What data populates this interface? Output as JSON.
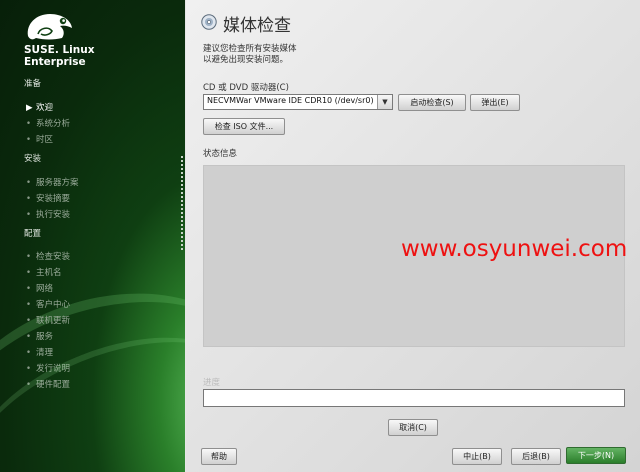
{
  "sidebar": {
    "brand_line1": "SUSE. Linux",
    "brand_line2": "Enterprise",
    "sections": [
      {
        "title": "准备",
        "items": [
          {
            "label": "欢迎",
            "active": true
          },
          {
            "label": "系统分析",
            "active": false
          },
          {
            "label": "时区",
            "active": false
          }
        ]
      },
      {
        "title": "安装",
        "items": [
          {
            "label": "服务器方案",
            "active": false
          },
          {
            "label": "安装摘要",
            "active": false
          },
          {
            "label": "执行安装",
            "active": false
          }
        ]
      },
      {
        "title": "配置",
        "items": [
          {
            "label": "检查安装",
            "active": false
          },
          {
            "label": "主机名",
            "active": false
          },
          {
            "label": "网络",
            "active": false
          },
          {
            "label": "客户中心",
            "active": false
          },
          {
            "label": "联机更新",
            "active": false
          },
          {
            "label": "服务",
            "active": false
          },
          {
            "label": "清理",
            "active": false
          },
          {
            "label": "发行说明",
            "active": false
          },
          {
            "label": "硬件配置",
            "active": false
          }
        ]
      }
    ]
  },
  "main": {
    "title": "媒体检查",
    "description_line1": "建议您检查所有安装媒体",
    "description_line2": "以避免出现安装问题。",
    "drive_label": "CD 或 DVD 驱动器(C)",
    "drive_value": "NECVMWar VMware IDE CDR10 (/dev/sr0)",
    "start_check_button": "启动检查(S)",
    "eject_button": "弹出(E)",
    "check_iso_button": "检查 ISO 文件...",
    "status_label": "状态信息",
    "progress_label": "进度",
    "progress_value": 0,
    "cancel_button": "取消(C)"
  },
  "footer": {
    "help_button": "帮助",
    "abort_button": "中止(B)",
    "back_button": "后退(B)",
    "next_button": "下一步(N)"
  },
  "watermark": "www.osyunwei.com",
  "colors": {
    "sidebar_green": "#0f3f12",
    "accent_green": "#2b7e2b",
    "watermark_red": "#ee1111"
  },
  "icons": {
    "logo": "suse-chameleon-icon",
    "title": "media-check-icon",
    "dropdown": "chevron-down-icon",
    "active_item": "triangle-right-icon",
    "item": "bullet-icon"
  }
}
